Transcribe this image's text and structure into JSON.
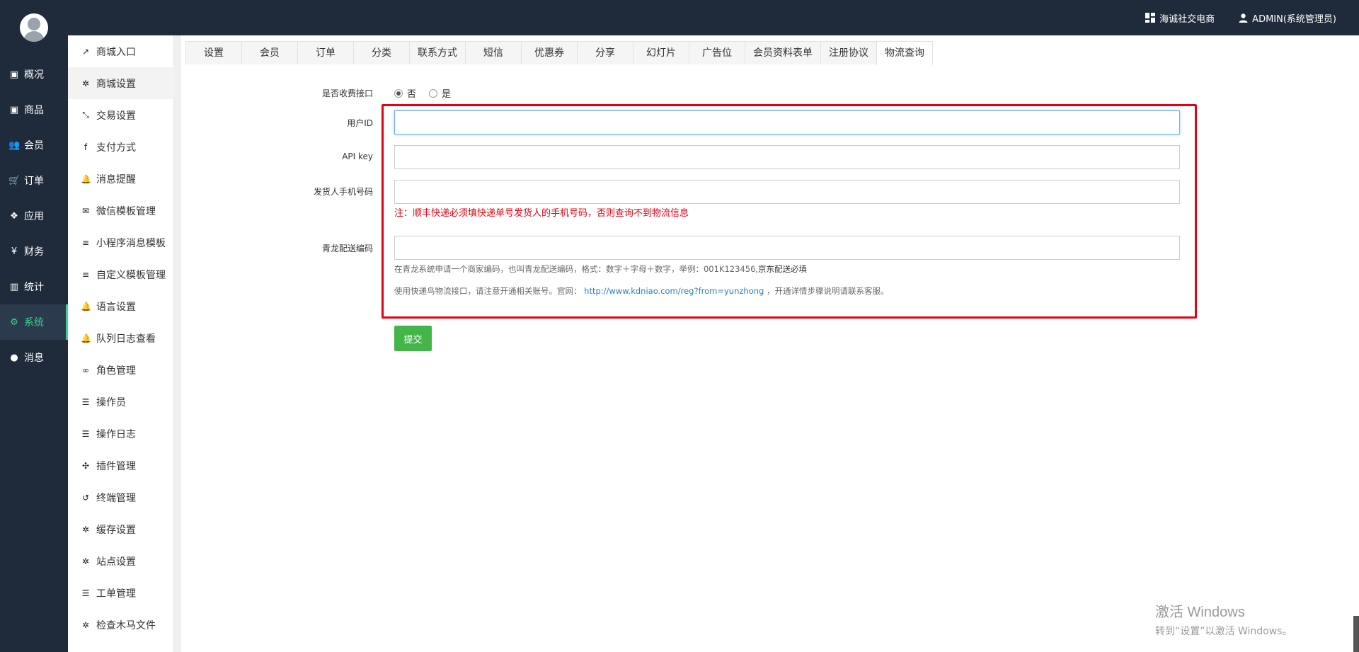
{
  "header": {
    "shop_name": "海诚社交电商",
    "user": "ADMIN(系统管理员)",
    "shop_icon": "grid-icon",
    "user_icon": "user-icon"
  },
  "main_nav": [
    {
      "label": "概况",
      "icon": "inbox-icon"
    },
    {
      "label": "商品",
      "icon": "inbox-icon"
    },
    {
      "label": "会员",
      "icon": "users-icon"
    },
    {
      "label": "订单",
      "icon": "cart-icon"
    },
    {
      "label": "应用",
      "icon": "cubes-icon"
    },
    {
      "label": "财务",
      "icon": "yen-icon"
    },
    {
      "label": "统计",
      "icon": "bar-chart-icon"
    },
    {
      "label": "系统",
      "icon": "cogs-icon"
    },
    {
      "label": "消息",
      "icon": "comment-icon"
    }
  ],
  "sub_nav": [
    {
      "label": "商城入口",
      "icon": "share-icon"
    },
    {
      "label": "商城设置",
      "icon": "gear-icon"
    },
    {
      "label": "交易设置",
      "icon": "compress-icon"
    },
    {
      "label": "支付方式",
      "icon": "facebook-icon"
    },
    {
      "label": "消息提醒",
      "icon": "bell-icon"
    },
    {
      "label": "微信模板管理",
      "icon": "wechat-icon"
    },
    {
      "label": "小程序消息模板",
      "icon": "bars-icon"
    },
    {
      "label": "自定义模板管理",
      "icon": "bars-icon"
    },
    {
      "label": "语言设置",
      "icon": "bell-icon"
    },
    {
      "label": "队列日志查看",
      "icon": "bell-icon"
    },
    {
      "label": "角色管理",
      "icon": "gamepad-icon"
    },
    {
      "label": "操作员",
      "icon": "list-icon"
    },
    {
      "label": "操作日志",
      "icon": "list-icon"
    },
    {
      "label": "插件管理",
      "icon": "puzzle-icon"
    },
    {
      "label": "终端管理",
      "icon": "history-icon"
    },
    {
      "label": "缓存设置",
      "icon": "gear-icon"
    },
    {
      "label": "站点设置",
      "icon": "gear-icon"
    },
    {
      "label": "工单管理",
      "icon": "list-icon"
    },
    {
      "label": "检查木马文件",
      "icon": "gear-icon"
    }
  ],
  "tabs": [
    "设置",
    "会员",
    "订单",
    "分类",
    "联系方式",
    "短信",
    "优惠券",
    "分享",
    "幻灯片",
    "广告位",
    "会员资料表单",
    "注册协议",
    "物流查询"
  ],
  "form": {
    "charge_label": "是否收费接口",
    "charge_no": "否",
    "charge_yes": "是",
    "user_id_label": "用户ID",
    "user_id_value": "",
    "api_key_label": "API key",
    "api_key_value": "",
    "phone_label": "发货人手机号码",
    "phone_value": "",
    "phone_warning": "注：顺丰快递必须填快递单号发货人的手机号码，否则查询不到物流信息",
    "qinglong_label": "青龙配送编码",
    "qinglong_value": "",
    "qinglong_help": "在青龙系统申请一个商家编码，也叫青龙配送编码，格式：数字＋字母＋数字，举例：001K123456,",
    "qinglong_help_bold": "京东配送必填",
    "kdniao_help_prefix": "使用快递鸟物流接口，请注意开通相关账号。官网：",
    "kdniao_link": "http://www.kdniao.com/reg?from=yunzhong",
    "kdniao_help_suffix": "，开通详情步骤说明请联系客服。",
    "submit_label": "提交"
  },
  "watermark": {
    "line1": "激活 Windows",
    "line2": "转到“设置”以激活 Windows。"
  },
  "colors": {
    "dark_bg": "#1f2b3a",
    "active_accent": "#3ecf8e",
    "highlight_box": "#e60012",
    "submit_green": "#44b549",
    "link_blue": "#2c7bbf"
  }
}
